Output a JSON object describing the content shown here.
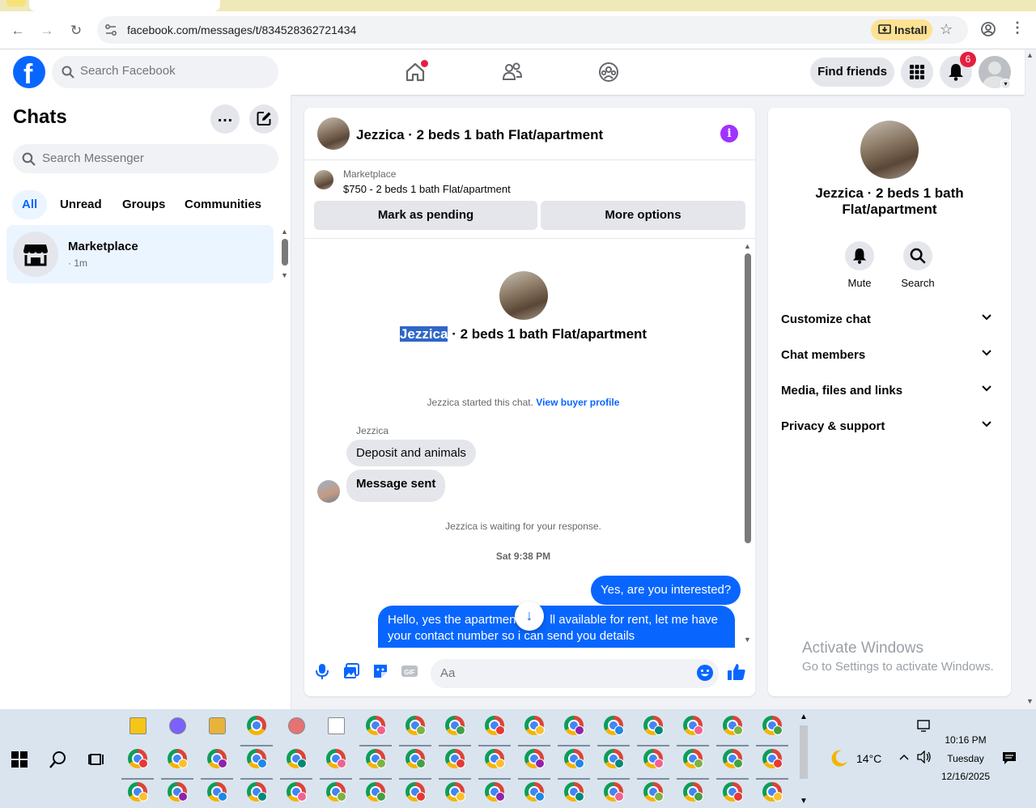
{
  "browser": {
    "url": "facebook.com/messages/t/834528362721434",
    "install_label": "Install"
  },
  "fb_header": {
    "search_placeholder": "Search Facebook",
    "find_friends_label": "Find friends",
    "notification_count": "6"
  },
  "chats": {
    "title": "Chats",
    "search_placeholder": "Search Messenger",
    "filters": [
      "All",
      "Unread",
      "Groups",
      "Communities"
    ],
    "active_filter": "All",
    "items": [
      {
        "name": "Marketplace",
        "time": "· 1m"
      }
    ]
  },
  "conversation": {
    "title": "Jezzica · 2 beds 1 bath Flat/apartment",
    "marketplace_label": "Marketplace",
    "listing": "$750 - 2 beds 1 bath Flat/apartment",
    "mark_pending_label": "Mark as pending",
    "more_options_label": "More options",
    "thread_title_highlight": "Jezzica",
    "thread_title_rest": " · 2 beds 1 bath Flat/apartment",
    "started_text": "Jezzica started this chat.",
    "view_buyer_profile": "View buyer profile",
    "sender_name": "Jezzica",
    "incoming_messages": [
      "Deposit and animals",
      "Message sent"
    ],
    "waiting_text": "Jezzica is waiting for your response.",
    "timestamp": "Sat 9:38 PM",
    "outgoing_messages": [
      "Yes, are you interested?",
      "Hello, yes the apartment is still available for rent, let me have your contact number so i can send you details"
    ],
    "outgoing_visible_line1": "Hello, yes the apartmen",
    "outgoing_visible_line1_end": "ll available for rent, let me have",
    "outgoing_visible_line2": "your contact number so i can send you details",
    "composer_placeholder": "Aa"
  },
  "details": {
    "title": "Jezzica · 2 beds 1 bath Flat/apartment",
    "actions": [
      "Mute",
      "Search"
    ],
    "sections": [
      "Customize chat",
      "Chat members",
      "Media, files and links",
      "Privacy & support"
    ]
  },
  "watermark": {
    "line1": "Activate Windows",
    "line2": "Go to Settings to activate Windows."
  },
  "taskbar": {
    "weather": "14°C",
    "time": "10:16 PM",
    "day": "Tuesday",
    "date": "12/16/2025"
  },
  "colors": {
    "fb_blue": "#0866ff",
    "badge_red": "#e41e3f",
    "info_purple": "#a033ff"
  }
}
